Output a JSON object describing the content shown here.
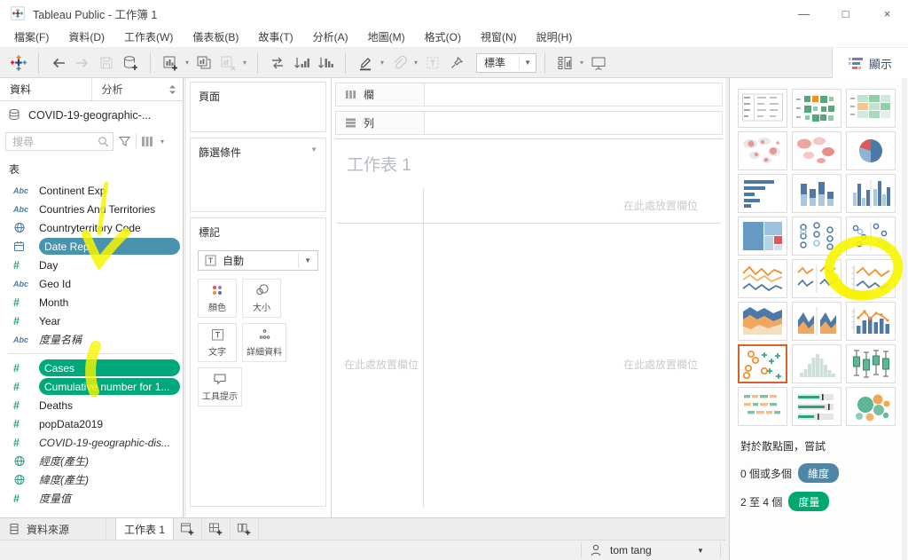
{
  "window": {
    "title": "Tableau Public - 工作簿 1",
    "controls": {
      "minimize": "—",
      "maximize": "□",
      "close": "×"
    }
  },
  "menu": {
    "items": [
      {
        "name": "file",
        "label": "檔案(F)"
      },
      {
        "name": "data",
        "label": "資料(D)"
      },
      {
        "name": "worksheet",
        "label": "工作表(W)"
      },
      {
        "name": "dashboard",
        "label": "儀表板(B)"
      },
      {
        "name": "story",
        "label": "故事(T)"
      },
      {
        "name": "analysis",
        "label": "分析(A)"
      },
      {
        "name": "map",
        "label": "地圖(M)"
      },
      {
        "name": "format",
        "label": "格式(O)"
      },
      {
        "name": "window",
        "label": "視窗(N)"
      },
      {
        "name": "help",
        "label": "說明(H)"
      }
    ]
  },
  "toolbar": {
    "fit_value": "標準",
    "showme_label": "顯示"
  },
  "data_pane": {
    "tab_data": "資料",
    "tab_analytics": "分析",
    "datasource_name": "COVID-19-geographic-...",
    "search_placeholder": "搜尋",
    "tables_header": "表",
    "fields": [
      {
        "name": "continent-exp",
        "icon": "abc",
        "label": "Continent Exp"
      },
      {
        "name": "countries-and-territories",
        "icon": "abc",
        "label": "Countries And Territories"
      },
      {
        "name": "countryterritory-code",
        "icon": "globe-blue",
        "label": "Countryterritory Code"
      },
      {
        "name": "date-rep",
        "icon": "calendar",
        "label": "Date Rep",
        "selected": "blue"
      },
      {
        "name": "day",
        "icon": "hash",
        "label": "Day"
      },
      {
        "name": "geo-id",
        "icon": "abc",
        "label": "Geo Id"
      },
      {
        "name": "month",
        "icon": "hash",
        "label": "Month"
      },
      {
        "name": "year",
        "icon": "hash",
        "label": "Year"
      },
      {
        "name": "measure-names",
        "icon": "abc",
        "label": "度量名稱",
        "italic": true
      },
      {
        "divider": true
      },
      {
        "name": "cases",
        "icon": "hash",
        "label": "Cases",
        "selected": "green"
      },
      {
        "name": "cumulative-number",
        "icon": "hash",
        "label": "Cumulative number for 1...",
        "selected": "green"
      },
      {
        "name": "deaths",
        "icon": "hash",
        "label": "Deaths"
      },
      {
        "name": "popdata2019",
        "icon": "hash",
        "label": "popData2019"
      },
      {
        "name": "covid-19-geographic-count",
        "icon": "hash",
        "label": "COVID-19-geographic-dis...",
        "italic": true
      },
      {
        "name": "longitude-generated",
        "icon": "globe-green",
        "label": "經度(產生)",
        "italic": true
      },
      {
        "name": "latitude-generated",
        "icon": "globe-green",
        "label": "緯度(產生)",
        "italic": true
      },
      {
        "name": "measure-values",
        "icon": "hash",
        "label": "度量值",
        "italic": true
      }
    ]
  },
  "cards": {
    "pages_label": "頁面",
    "filters_label": "篩選條件",
    "marks_label": "標記",
    "mark_type": "自動",
    "buttons": [
      {
        "name": "color",
        "label": "顏色"
      },
      {
        "name": "size",
        "label": "大小"
      },
      {
        "name": "text",
        "label": "文字"
      },
      {
        "name": "detail",
        "label": "詳細資料",
        "wide": true
      },
      {
        "name": "tooltip",
        "label": "工具提示",
        "wide": true
      }
    ]
  },
  "shelves": {
    "columns_label": "欄",
    "rows_label": "列"
  },
  "canvas": {
    "sheet_title": "工作表 1",
    "drop_zone_text": "在此處放置欄位"
  },
  "show_me": {
    "charts": [
      {
        "type": "text-table"
      },
      {
        "type": "heat-map"
      },
      {
        "type": "highlight-table"
      },
      {
        "type": "symbol-map"
      },
      {
        "type": "filled-map"
      },
      {
        "type": "pie-chart"
      },
      {
        "type": "horizontal-bars"
      },
      {
        "type": "stacked-bars"
      },
      {
        "type": "side-by-side-bars"
      },
      {
        "type": "treemap"
      },
      {
        "type": "circle-views"
      },
      {
        "type": "side-by-side-circles"
      },
      {
        "type": "lines-continuous"
      },
      {
        "type": "lines-discrete"
      },
      {
        "type": "dual-lines",
        "annotated": true
      },
      {
        "type": "area-continuous"
      },
      {
        "type": "area-discrete"
      },
      {
        "type": "dual-combination"
      },
      {
        "type": "scatter-plot",
        "selected": true
      },
      {
        "type": "histogram"
      },
      {
        "type": "box-and-whisker"
      },
      {
        "type": "gantt"
      },
      {
        "type": "bullet-graph"
      },
      {
        "type": "packed-bubbles"
      }
    ],
    "hint_title": "對於散點圖，嘗試",
    "dimension_hint": {
      "prefix": "0 個或多個",
      "pill": "維度"
    },
    "measure_hint": {
      "prefix": "2 至 4 個",
      "pill": "度量"
    }
  },
  "sheet_tabs": {
    "datasource_label": "資料來源",
    "sheet1_label": "工作表 1"
  },
  "status_bar": {
    "user_name": "tom tang"
  },
  "colors": {
    "selection_blue": "#4a93af",
    "selection_green": "#00a87b",
    "pill_dimension": "#4e87a5",
    "pill_measure": "#00a86e",
    "selected_thumb_border": "#d4622a",
    "annotation_yellow": "#f7f400"
  }
}
